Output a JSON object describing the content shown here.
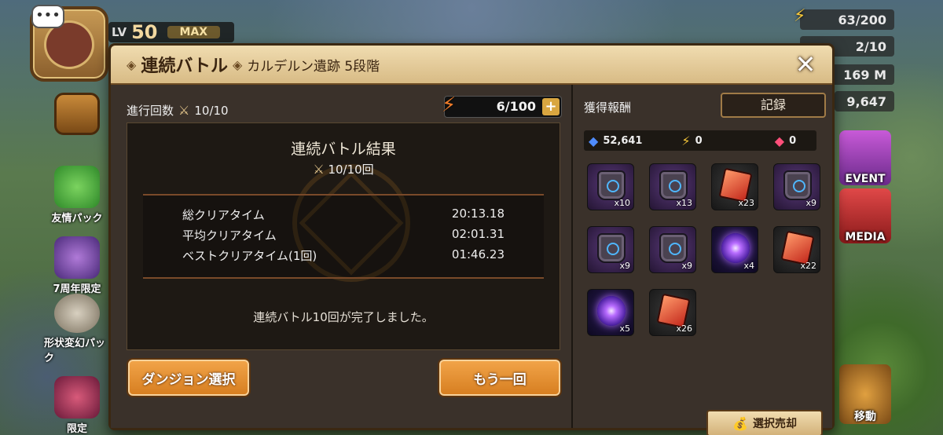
{
  "hud": {
    "energy": "63/200",
    "arena_wings": "2/10",
    "mana": "169 M",
    "crystals": "9,647"
  },
  "player": {
    "level_label": "LV",
    "level": "50",
    "max_label": "MAX"
  },
  "side_buttons": [
    {
      "label": "友情パック"
    },
    {
      "label": "7周年限定"
    },
    {
      "label": "形状変幻パック"
    },
    {
      "label": "限定"
    }
  ],
  "right_buttons": [
    {
      "label": "EVENT"
    },
    {
      "label": "MEDIA"
    },
    {
      "label": "移動"
    }
  ],
  "dialog": {
    "title": "連続バトル",
    "subtitle": "カルデルン遺跡 5段階",
    "progress_label": "進行回数",
    "progress_value": "10/10",
    "energy_value": "6/100",
    "result": {
      "heading": "連続バトル結果",
      "count": "10/10回",
      "stats": [
        {
          "label": "総クリアタイム",
          "value": "20:13.18"
        },
        {
          "label": "平均クリアタイム",
          "value": "02:01.31"
        },
        {
          "label": "ベストクリアタイム(1回)",
          "value": "01:46.23"
        }
      ],
      "done_message": "連続バトル10回が完了しました。"
    },
    "buttons": {
      "dungeon_select": "ダンジョン選択",
      "retry": "もう一回"
    },
    "rewards": {
      "title": "獲得報酬",
      "record_button": "記録",
      "crystals": "52,641",
      "energy": "0",
      "rubies": "0",
      "items": [
        {
          "type": "rune",
          "qty": "x10"
        },
        {
          "type": "rune",
          "qty": "x13"
        },
        {
          "type": "red",
          "qty": "x23"
        },
        {
          "type": "rune",
          "qty": "x9"
        },
        {
          "type": "rune",
          "qty": "x9"
        },
        {
          "type": "rune",
          "qty": "x9"
        },
        {
          "type": "orb",
          "qty": "x4"
        },
        {
          "type": "red",
          "qty": "x22"
        },
        {
          "type": "orb",
          "qty": "x5"
        },
        {
          "type": "red",
          "qty": "x26"
        }
      ],
      "sell_button": "選択売却"
    }
  }
}
